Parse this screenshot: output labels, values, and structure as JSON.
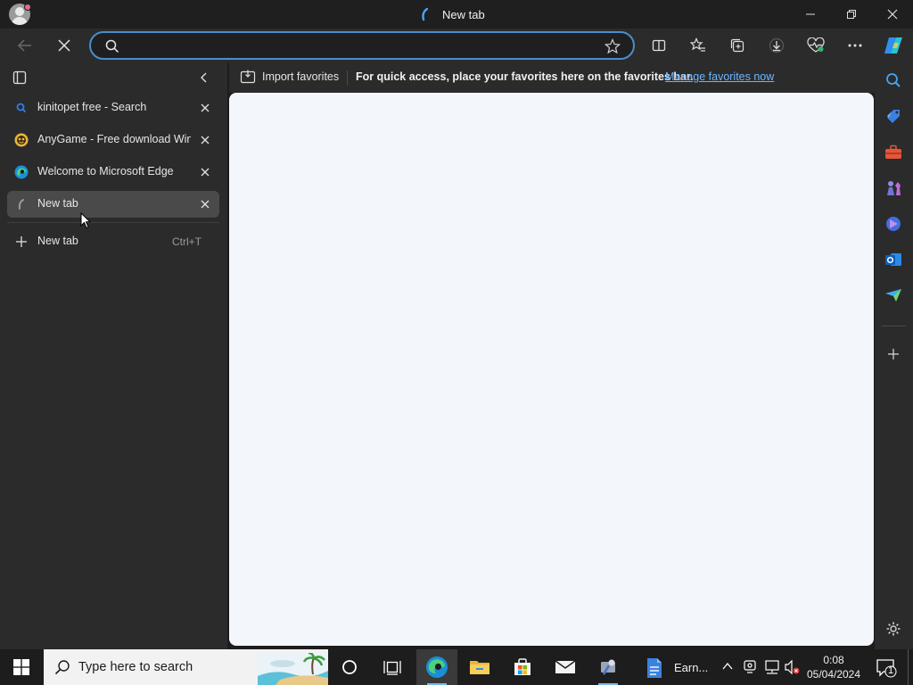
{
  "window": {
    "title": "New tab"
  },
  "toolbar": {
    "address_value": "",
    "address_placeholder": ""
  },
  "tabs": [
    {
      "title": "kinitopet free - Search",
      "favicon": "search-favicon",
      "active": false
    },
    {
      "title": "AnyGame - Free download Windows games",
      "favicon": "anygame-favicon",
      "active": false
    },
    {
      "title": "Welcome to Microsoft Edge",
      "favicon": "edge-favicon",
      "active": false
    },
    {
      "title": "New tab",
      "favicon": "loading-favicon",
      "active": true
    }
  ],
  "new_tab": {
    "label": "New tab",
    "shortcut": "Ctrl+T"
  },
  "favorites_bar": {
    "import_label": "Import favorites",
    "message": "For quick access, place your favorites here on the favorites bar.",
    "link_label": "Manage favorites now"
  },
  "sidebar": {
    "icons": [
      "search-icon",
      "shopping-tag-icon",
      "tools-icon",
      "games-icon",
      "copilot-icon",
      "outlook-icon",
      "drop-icon",
      "add-icon",
      "settings-icon"
    ]
  },
  "taskbar": {
    "search_placeholder": "Type here to search",
    "earn_app_label": "Earn...",
    "time": "0:08",
    "date": "05/04/2024",
    "notification_count": "1"
  },
  "colors": {
    "accent": "#4a8ecd",
    "link": "#6bb6ff",
    "content_bg": "#f3f6fa"
  }
}
